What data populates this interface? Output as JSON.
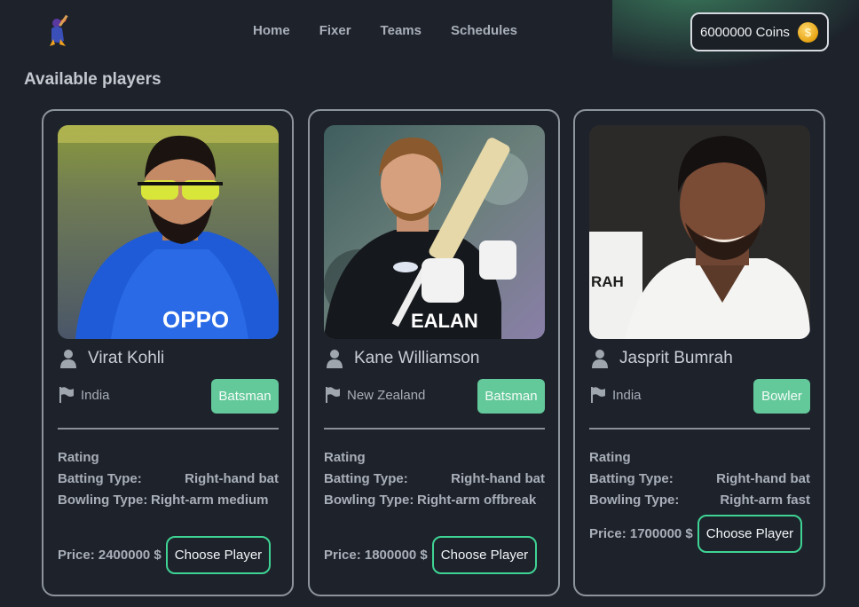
{
  "nav": {
    "links": [
      "Home",
      "Fixer",
      "Teams",
      "Schedules"
    ],
    "coins_label": "6000000 Coins"
  },
  "section_title": "Available players",
  "players": [
    {
      "name": "Virat Kohli",
      "country": "India",
      "role": "Batsman",
      "rating_label": "Rating",
      "batting_label": "Batting Type:",
      "batting_value": "Right-hand bat",
      "bowling_label": "Bowling Type:",
      "bowling_value": "Right-arm medium",
      "price": "Price: 2400000 $",
      "button": "Choose Player"
    },
    {
      "name": "Kane Williamson",
      "country": "New Zealand",
      "role": "Batsman",
      "rating_label": "Rating",
      "batting_label": "Batting Type:",
      "batting_value": "Right-hand bat",
      "bowling_label": "Bowling Type:",
      "bowling_value": "Right-arm offbreak",
      "price": "Price: 1800000 $",
      "button": "Choose Player"
    },
    {
      "name": "Jasprit Bumrah",
      "country": "India",
      "role": "Bowler",
      "rating_label": "Rating",
      "batting_label": "Batting Type:",
      "batting_value": "Right-hand bat",
      "bowling_label": "Bowling Type:",
      "bowling_value": "Right-arm fast",
      "price": "Price: 1700000 $",
      "button": "Choose Player"
    }
  ],
  "photo_texts": {
    "p2_shirt": "EALAN",
    "p3_bg": "RAH"
  },
  "colors": {
    "accent": "#63c99a",
    "button_border": "#3fd394",
    "background": "#1d222b"
  }
}
